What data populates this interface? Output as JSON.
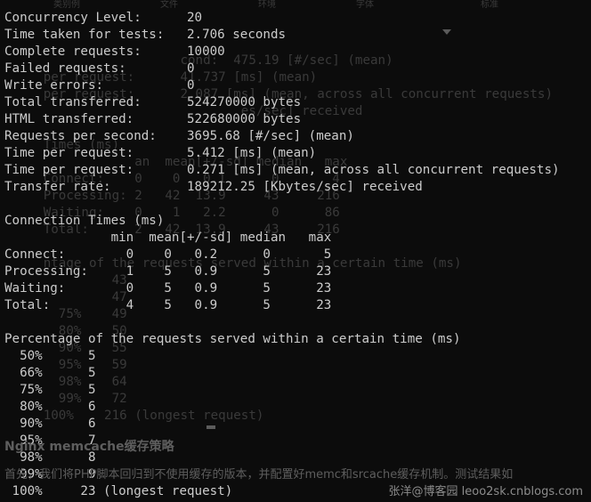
{
  "terminal": {
    "lines": [
      "Concurrency Level:      20",
      "Time taken for tests:   2.706 seconds",
      "Complete requests:      10000",
      "Failed requests:        0",
      "Write errors:           0",
      "Total transferred:      524270000 bytes",
      "HTML transferred:       522680000 bytes",
      "Requests per second:    3695.68 [#/sec] (mean)",
      "Time per request:       5.412 [ms] (mean)",
      "Time per request:       0.271 [ms] (mean, across all concurrent requests)",
      "Transfer rate:          189212.25 [Kbytes/sec] received",
      "",
      "Connection Times (ms)",
      "              min  mean[+/-sd] median   max",
      "Connect:        0    0   0.2      0       5",
      "Processing:     1    5   0.9      5      23",
      "Waiting:        0    5   0.9      5      23",
      "Total:          4    5   0.9      5      23",
      "",
      "Percentage of the requests served within a certain time (ms)",
      "  50%      5",
      "  66%      5",
      "  75%      5",
      "  80%      6",
      "  90%      6",
      "  95%      7",
      "  98%      8",
      "  99%      9",
      " 100%     23 (longest request)"
    ]
  },
  "background_page": {
    "tabs": [
      "类别例",
      "文件",
      "环境",
      "字体",
      "标准"
    ],
    "ghost_lines": [
      "                       cond:  475.19 [#/sec] (mean)",
      "     per request:      41.737 [ms] (mean)",
      "     per request:      2.087 [ms] (mean, across all concurrent requests)",
      "                               es/sec] received",
      "",
      "     Times (ms)",
      "                 an  mean[+/-sd] median   max",
      "     Connect:    0    0   0.1      0       4",
      "     Processing: 2   42  13.9     43     216",
      "     Waiting:    0    1   2.2      0      86",
      "     Total:      2   42  13.9     43     216",
      "",
      "     ntage of the requests served within a certain time (ms)",
      "              43",
      "              47",
      "       75%    49",
      "       80%    50",
      "       90%    55",
      "       95%    59",
      "       98%    64",
      "       99%    72",
      "     100%    216 (longest request)"
    ],
    "heading": "Nginx memcache缓存策略",
    "paragraph": "首先，我们将PHP脚本回归到不使用缓存的版本，并配置好memc和srcache缓存机制。测试结果如"
  },
  "watermark": "张洋@博客园 leoo2sk.cnblogs.com",
  "icons": {
    "dropdown": "caret-down-icon",
    "cursor": "text-cursor-icon"
  },
  "colors": {
    "terminal_bg": "#0c0c0c",
    "terminal_fg": "#cccccc",
    "ghost_text": "#3a3a3a",
    "watermark": "#8c8c8c"
  }
}
